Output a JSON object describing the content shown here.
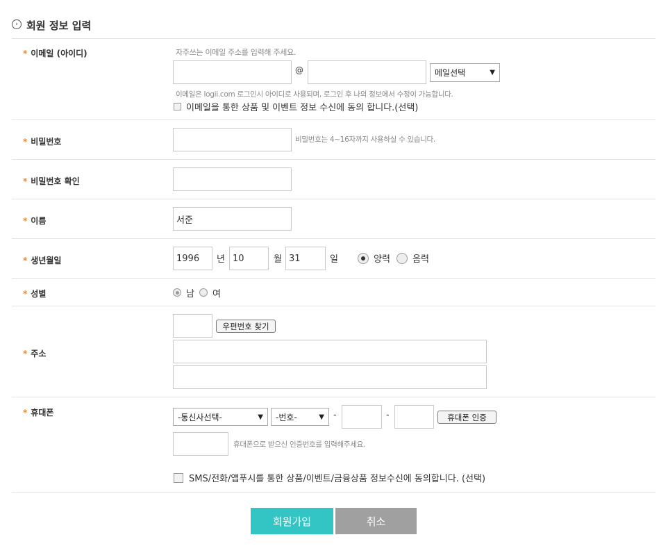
{
  "section": {
    "title": "회원 정보 입력",
    "icon": "chevron-right-circle-icon"
  },
  "required_mark": "*",
  "email": {
    "label": "이메일 (아이디)",
    "hint_top": "자주쓰는 이메일 주소를 입력해 주세요.",
    "local_value": "",
    "at": "@",
    "domain_value": "",
    "domain_select": "메일선택",
    "hint_bottom": "이메일은 logii.com 로그인시 아이디로 사용되며, 로그인 후 나의 정보에서 수정이 가능합니다.",
    "consent": "이메일을 통한 상품 및 이벤트 정보 수신에 동의 합니다.(선택)"
  },
  "password": {
    "label": "비밀번호",
    "value": "",
    "hint": "비밀번호는 4~16자까지 사용하실 수 있습니다."
  },
  "password_confirm": {
    "label": "비밀번호 확인",
    "value": ""
  },
  "name": {
    "label": "이름",
    "value": "서준"
  },
  "birth": {
    "label": "생년월일",
    "year": "1996",
    "year_unit": "년",
    "month": "10",
    "month_unit": "월",
    "day": "31",
    "day_unit": "일",
    "solar": "양력",
    "lunar": "음력",
    "selected": "양력"
  },
  "gender": {
    "label": "성별",
    "male": "남",
    "female": "여",
    "selected": "남"
  },
  "address": {
    "label": "주소",
    "zip_value": "",
    "zip_button": "우편번호 찾기",
    "line1": "",
    "line2": ""
  },
  "phone": {
    "label": "휴대폰",
    "carrier_select": "-통신사선택-",
    "prefix_select": "-번호-",
    "dash": "-",
    "mid": "",
    "last": "",
    "verify_button": "휴대폰 인증",
    "code_value": "",
    "code_hint": "휴대폰으로 받으신 인증번호를 입력해주세요.",
    "consent": "SMS/전화/앱푸시를 통한 상품/이벤트/금융상품 정보수신에 동의합니다. (선택)"
  },
  "buttons": {
    "submit": "회원가입",
    "cancel": "취소"
  },
  "colors": {
    "submit_bg": "#33c5c3",
    "cancel_bg": "#a0a0a0",
    "required": "#f08a2c"
  }
}
